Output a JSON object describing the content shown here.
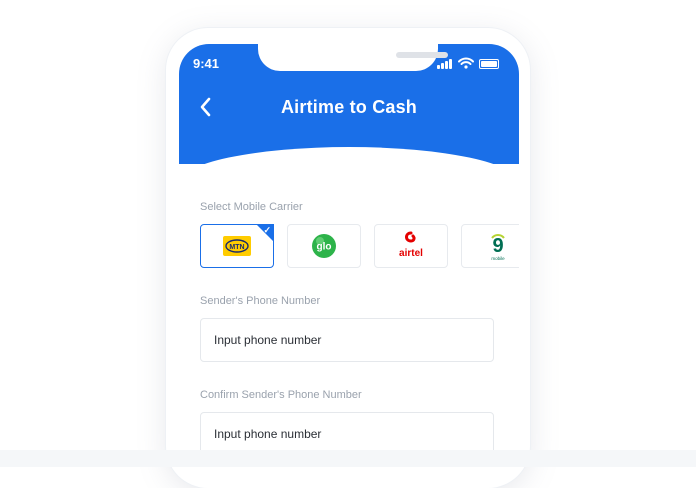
{
  "status_bar": {
    "time": "9:41"
  },
  "header": {
    "title": "Airtime to Cash"
  },
  "carrier_section": {
    "label": "Select Mobile Carrier",
    "carriers": [
      {
        "name": "MTN",
        "logo_text": "MTN",
        "selected": true,
        "color": "#ffcc00"
      },
      {
        "name": "Glo",
        "logo_text": "glo",
        "selected": false,
        "color": "#2db34a"
      },
      {
        "name": "Airtel",
        "logo_text": "airtel",
        "selected": false,
        "color": "#e40000"
      },
      {
        "name": "9mobile",
        "logo_text": "9",
        "sub_text": "mobile",
        "selected": false,
        "color": "#006e53"
      }
    ]
  },
  "sender_phone": {
    "label": "Sender's Phone Number",
    "placeholder": "Input phone number"
  },
  "confirm_phone": {
    "label": "Confirm Sender's Phone Number",
    "placeholder": "Input phone number"
  },
  "colors": {
    "primary": "#1a6fe8",
    "label": "#9aa2ad",
    "border": "#e5e8ec"
  }
}
